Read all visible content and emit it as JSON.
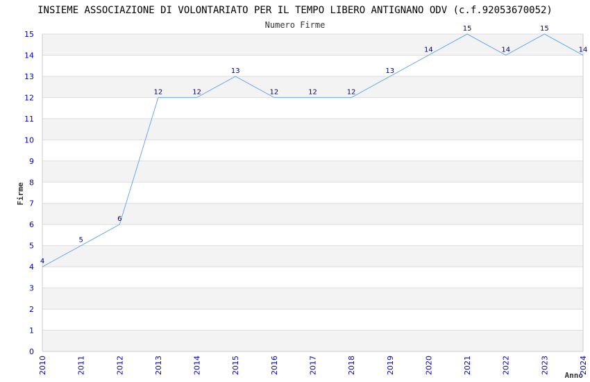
{
  "chart_data": {
    "type": "line",
    "title": "INSIEME ASSOCIAZIONE DI VOLONTARIATO PER IL TEMPO LIBERO ANTIGNANO ODV (c.f.92053670052)",
    "subtitle": "Numero Firme",
    "xlabel": "Anno",
    "ylabel": "Firme",
    "x": [
      "2010",
      "2011",
      "2012",
      "2013",
      "2014",
      "2015",
      "2016",
      "2017",
      "2018",
      "2019",
      "2020",
      "2021",
      "2022",
      "2023",
      "2024"
    ],
    "values": [
      4,
      5,
      6,
      12,
      12,
      13,
      12,
      12,
      12,
      13,
      14,
      15,
      14,
      15,
      14
    ],
    "ylim": [
      0,
      15
    ],
    "yticks": [
      0,
      1,
      2,
      3,
      4,
      5,
      6,
      7,
      8,
      9,
      10,
      11,
      12,
      13,
      14,
      15
    ],
    "grid": true,
    "line_color": "#66aaee",
    "band_color": "#f3f3f3",
    "tick_color": "#0000cc",
    "label_color": "#000066"
  }
}
